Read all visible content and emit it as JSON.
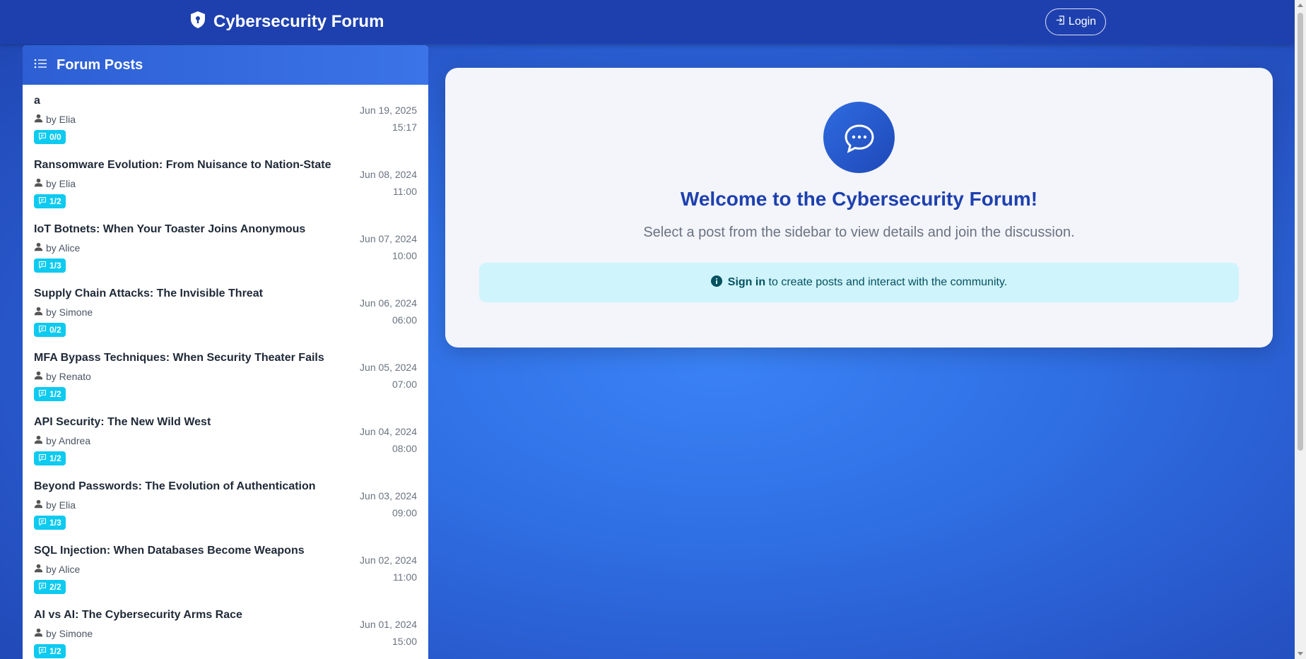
{
  "navbar": {
    "title": "Cybersecurity Forum",
    "login_label": "Login"
  },
  "sidebar": {
    "header": "Forum Posts",
    "posts": [
      {
        "title": "a",
        "author": "by Elia",
        "comments": "0/0",
        "date": "Jun 19, 2025",
        "time": "15:17"
      },
      {
        "title": "Ransomware Evolution: From Nuisance to Nation-State",
        "author": "by Elia",
        "comments": "1/2",
        "date": "Jun 08, 2024",
        "time": "11:00"
      },
      {
        "title": "IoT Botnets: When Your Toaster Joins Anonymous",
        "author": "by Alice",
        "comments": "1/3",
        "date": "Jun 07, 2024",
        "time": "10:00"
      },
      {
        "title": "Supply Chain Attacks: The Invisible Threat",
        "author": "by Simone",
        "comments": "0/2",
        "date": "Jun 06, 2024",
        "time": "06:00"
      },
      {
        "title": "MFA Bypass Techniques: When Security Theater Fails",
        "author": "by Renato",
        "comments": "1/2",
        "date": "Jun 05, 2024",
        "time": "07:00"
      },
      {
        "title": "API Security: The New Wild West",
        "author": "by Andrea",
        "comments": "1/2",
        "date": "Jun 04, 2024",
        "time": "08:00"
      },
      {
        "title": "Beyond Passwords: The Evolution of Authentication",
        "author": "by Elia",
        "comments": "1/3",
        "date": "Jun 03, 2024",
        "time": "09:00"
      },
      {
        "title": "SQL Injection: When Databases Become Weapons",
        "author": "by Alice",
        "comments": "2/2",
        "date": "Jun 02, 2024",
        "time": "11:00"
      },
      {
        "title": "AI vs AI: The Cybersecurity Arms Race",
        "author": "by Simone",
        "comments": "1/2",
        "date": "Jun 01, 2024",
        "time": "15:00"
      }
    ]
  },
  "main": {
    "welcome_title": "Welcome to the Cybersecurity Forum!",
    "welcome_subtitle": "Select a post from the sidebar to view details and join the discussion.",
    "alert_signin": "Sign in",
    "alert_rest": " to create posts and interact with the community."
  },
  "colors": {
    "navbar": "#1e40af",
    "accent": "#1e40af",
    "badge": "#0dcaf0",
    "alert_bg": "#cff4fc"
  },
  "icons": {
    "brand": "shield-lock-icon",
    "login": "box-arrow-in-icon",
    "sidebar_header": "list-icon",
    "author": "person-icon",
    "comments": "chat-icon",
    "welcome": "chat-dots-icon",
    "alert": "info-circle-icon"
  }
}
